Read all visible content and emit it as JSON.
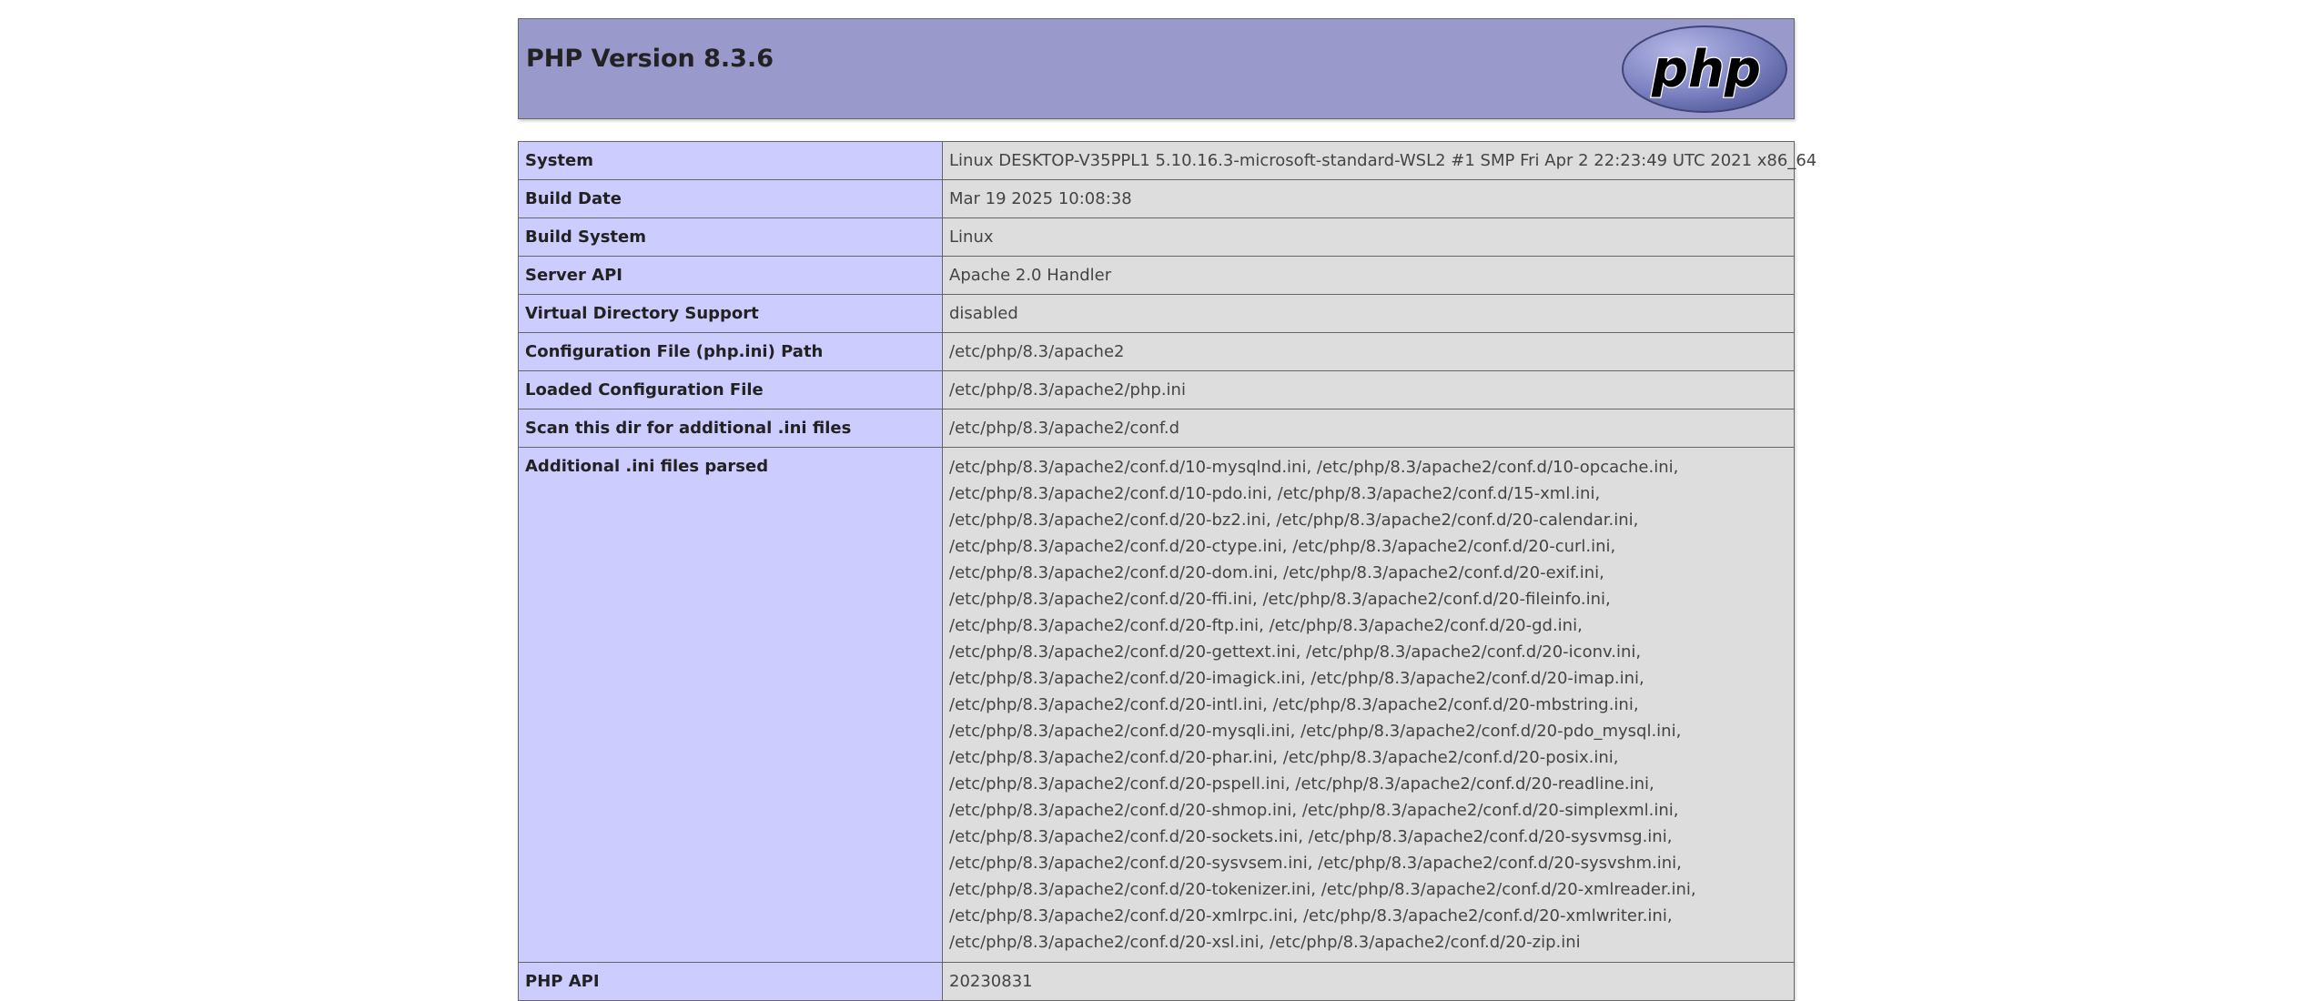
{
  "header": {
    "title": "PHP Version 8.3.6",
    "logo_text": "php",
    "logo_icon": "php-logo-icon"
  },
  "colors": {
    "header_bg": "#9999cc",
    "key_cell_bg": "#ccccff",
    "value_cell_bg": "#dddddd",
    "border": "#666666"
  },
  "rows": [
    {
      "key": "System",
      "value": "Linux DESKTOP-V35PPL1 5.10.16.3-microsoft-standard-WSL2 #1 SMP Fri Apr 2 22:23:49 UTC 2021 x86_64"
    },
    {
      "key": "Build Date",
      "value": "Mar 19 2025 10:08:38"
    },
    {
      "key": "Build System",
      "value": "Linux"
    },
    {
      "key": "Server API",
      "value": "Apache 2.0 Handler"
    },
    {
      "key": "Virtual Directory Support",
      "value": "disabled"
    },
    {
      "key": "Configuration File (php.ini) Path",
      "value": "/etc/php/8.3/apache2"
    },
    {
      "key": "Loaded Configuration File",
      "value": "/etc/php/8.3/apache2/php.ini"
    },
    {
      "key": "Scan this dir for additional .ini files",
      "value": "/etc/php/8.3/apache2/conf.d"
    },
    {
      "key": "Additional .ini files parsed",
      "lines": [
        "/etc/php/8.3/apache2/conf.d/10-mysqlnd.ini, /etc/php/8.3/apache2/conf.d/10-opcache.ini,",
        "/etc/php/8.3/apache2/conf.d/10-pdo.ini, /etc/php/8.3/apache2/conf.d/15-xml.ini,",
        "/etc/php/8.3/apache2/conf.d/20-bz2.ini, /etc/php/8.3/apache2/conf.d/20-calendar.ini,",
        "/etc/php/8.3/apache2/conf.d/20-ctype.ini, /etc/php/8.3/apache2/conf.d/20-curl.ini,",
        "/etc/php/8.3/apache2/conf.d/20-dom.ini, /etc/php/8.3/apache2/conf.d/20-exif.ini,",
        "/etc/php/8.3/apache2/conf.d/20-ffi.ini, /etc/php/8.3/apache2/conf.d/20-fileinfo.ini,",
        "/etc/php/8.3/apache2/conf.d/20-ftp.ini, /etc/php/8.3/apache2/conf.d/20-gd.ini,",
        "/etc/php/8.3/apache2/conf.d/20-gettext.ini, /etc/php/8.3/apache2/conf.d/20-iconv.ini,",
        "/etc/php/8.3/apache2/conf.d/20-imagick.ini, /etc/php/8.3/apache2/conf.d/20-imap.ini,",
        "/etc/php/8.3/apache2/conf.d/20-intl.ini, /etc/php/8.3/apache2/conf.d/20-mbstring.ini,",
        "/etc/php/8.3/apache2/conf.d/20-mysqli.ini, /etc/php/8.3/apache2/conf.d/20-pdo_mysql.ini,",
        "/etc/php/8.3/apache2/conf.d/20-phar.ini, /etc/php/8.3/apache2/conf.d/20-posix.ini,",
        "/etc/php/8.3/apache2/conf.d/20-pspell.ini, /etc/php/8.3/apache2/conf.d/20-readline.ini,",
        "/etc/php/8.3/apache2/conf.d/20-shmop.ini, /etc/php/8.3/apache2/conf.d/20-simplexml.ini,",
        "/etc/php/8.3/apache2/conf.d/20-sockets.ini, /etc/php/8.3/apache2/conf.d/20-sysvmsg.ini,",
        "/etc/php/8.3/apache2/conf.d/20-sysvsem.ini, /etc/php/8.3/apache2/conf.d/20-sysvshm.ini,",
        "/etc/php/8.3/apache2/conf.d/20-tokenizer.ini, /etc/php/8.3/apache2/conf.d/20-xmlreader.ini,",
        "/etc/php/8.3/apache2/conf.d/20-xmlrpc.ini, /etc/php/8.3/apache2/conf.d/20-xmlwriter.ini,",
        "/etc/php/8.3/apache2/conf.d/20-xsl.ini, /etc/php/8.3/apache2/conf.d/20-zip.ini"
      ]
    },
    {
      "key": "PHP API",
      "value": "20230831"
    }
  ]
}
